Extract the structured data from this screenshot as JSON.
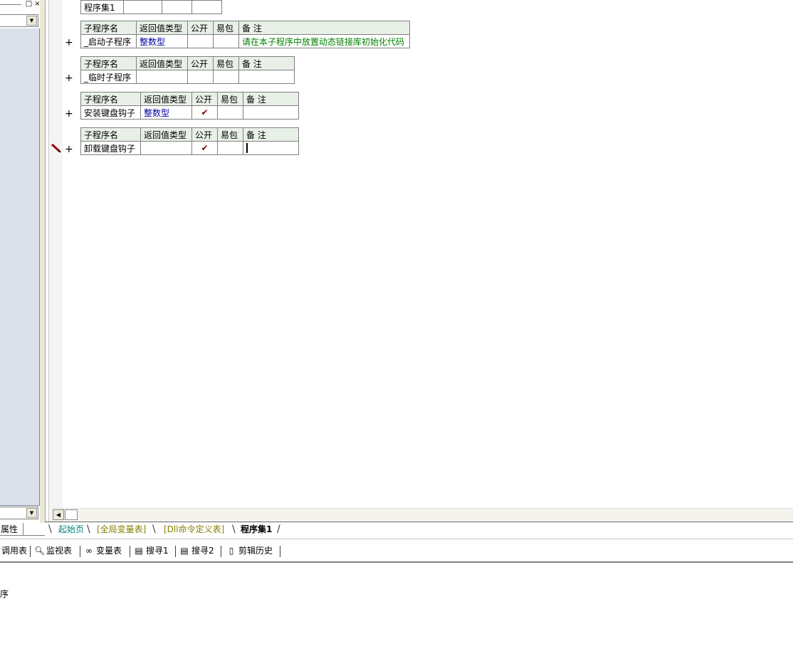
{
  "left_panel": {
    "window_buttons": [
      "□",
      "×"
    ],
    "properties_tab": "属性"
  },
  "program_set": {
    "name": "程序集1"
  },
  "subroutine_headers": {
    "name": "子程序名",
    "return_type": "返回值类型",
    "public": "公开",
    "easy_pack": "易包",
    "note": "备 注"
  },
  "subroutines": [
    {
      "name": "_启动子程序",
      "return_type": "整数型",
      "public": "",
      "note": "请在本子程序中放置动态链接库初始化代码"
    },
    {
      "name": "_临时子程序",
      "return_type": "",
      "public": "",
      "note": ""
    },
    {
      "name": "安装键盘钩子",
      "return_type": "整数型",
      "public": "✔",
      "note": ""
    },
    {
      "name": "卸载键盘钩子",
      "return_type": "",
      "public": "✔",
      "note": ""
    }
  ],
  "tabs": [
    {
      "label": "起始页",
      "color": "#008080"
    },
    {
      "label": "[全局变量表]",
      "color": "#808000"
    },
    {
      "label": "[Dll命令定义表]",
      "color": "#808000"
    },
    {
      "label": "程序集1",
      "active": true
    }
  ],
  "toolbar": [
    {
      "label": "调用表",
      "icon": "call-table-icon"
    },
    {
      "label": "监视表",
      "icon": "magnifier-icon"
    },
    {
      "label": "变量表",
      "icon": "variable-icon"
    },
    {
      "label": "搜寻1",
      "icon": "search-doc-icon"
    },
    {
      "label": "搜寻2",
      "icon": "search-doc-icon"
    },
    {
      "label": "剪辑历史",
      "icon": "clipboard-icon"
    }
  ],
  "output": {
    "text": "序"
  }
}
